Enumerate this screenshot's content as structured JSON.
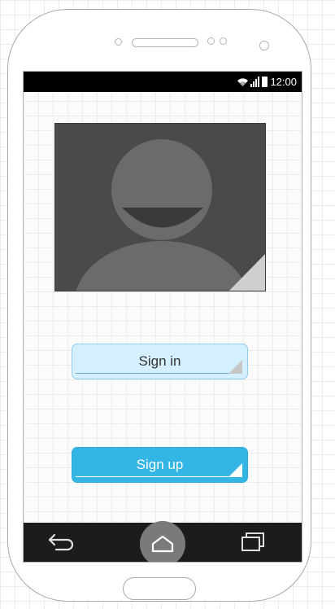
{
  "status_bar": {
    "time": "12:00",
    "icons": [
      "wifi-icon",
      "signal-icon",
      "battery-icon"
    ]
  },
  "avatar": {
    "icon": "user-silhouette-icon"
  },
  "buttons": {
    "sign_in": "Sign in",
    "sign_up": "Sign up"
  },
  "nav_bar": {
    "icons": [
      "back-icon",
      "home-icon",
      "recent-apps-icon"
    ]
  },
  "colors": {
    "sign_in_bg": "#d4efff",
    "sign_up_bg": "#33b5e5",
    "status_bar_bg": "#000000",
    "nav_bar_bg": "#1c1c1c",
    "avatar_bg": "#4a4a4a"
  }
}
